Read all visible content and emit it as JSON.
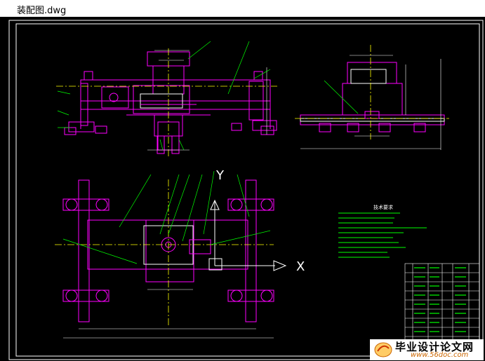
{
  "window": {
    "title": "装配图.dwg"
  },
  "drawing": {
    "axis_y": "Y",
    "axis_x": "X",
    "tech_title": "技术要求"
  },
  "watermark": {
    "brand": "毕业设计论文网",
    "url": "www.56doc.com"
  },
  "colors": {
    "background": "#000000",
    "outline": "#ff00ff",
    "centerline": "#ffff00",
    "leader": "#00ff00",
    "text": "#ffffff",
    "frame": "#ffffff"
  }
}
